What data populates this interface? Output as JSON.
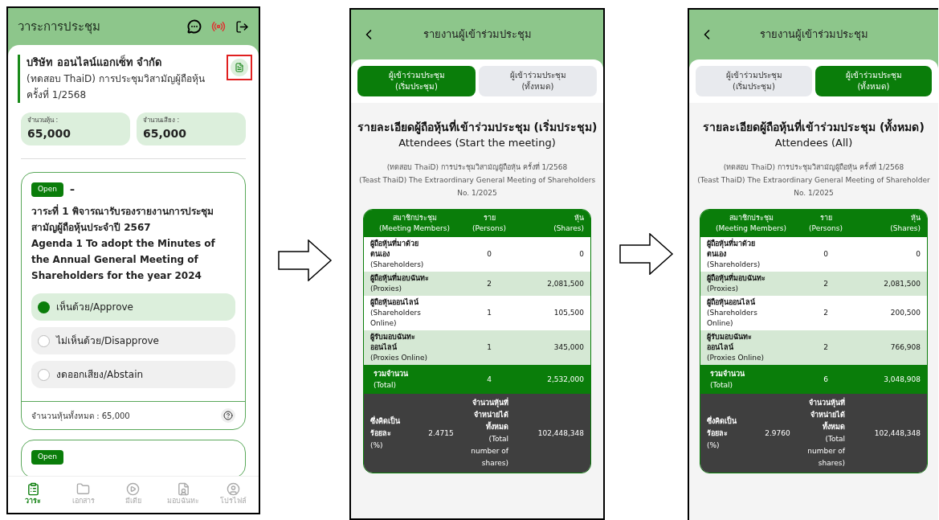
{
  "agenda_screen": {
    "title": "วาระการประชุม",
    "company": {
      "name": "บริษัท ออนไลน์แอกเซ็ท จำกัด",
      "meeting": "(ทดสอบ ThaiD) การประชุมวิสามัญผู้ถือหุ้น ครั้งที่ 1/2568",
      "document_marked": true
    },
    "stats": [
      {
        "label": "จำนวนหุ้น :",
        "value": "65,000"
      },
      {
        "label": "จำนวนเสียง :",
        "value": "65,000"
      }
    ],
    "agendas": [
      {
        "status": "Open",
        "suffix": "–",
        "title_th": "วาระที่ 1 พิจารณารับรองรายงานการประชุมสามัญผู้ถือหุ้นประจำปี 2567",
        "title_en": "Agenda 1 To adopt the Minutes of the Annual General Meeting of Shareholders for the year 2024",
        "options": [
          {
            "label": "เห็นด้วย/Approve",
            "selected": true
          },
          {
            "label": "ไม่เห็นด้วย/Disapprove",
            "selected": false
          },
          {
            "label": "งดออกเสียง/Abstain",
            "selected": false
          }
        ],
        "total": "จำนวนหุ้นทั้งหมด : 65,000"
      },
      {
        "status": "Open"
      }
    ],
    "nav": [
      {
        "label": "วาระ",
        "selected": true
      },
      {
        "label": "เอกสาร",
        "selected": false
      },
      {
        "label": "มีเดีย",
        "selected": false
      },
      {
        "label": "มอบฉันทะ",
        "selected": false
      },
      {
        "label": "โปรไฟล์",
        "selected": false
      }
    ]
  },
  "reports": [
    {
      "title": "รายงานผู้เข้าร่วมประชุม",
      "tabs": [
        {
          "line1": "ผู้เข้าร่วมประชุม",
          "line2": "(เริ่มประชุม)",
          "selected": true
        },
        {
          "line1": "ผู้เข้าร่วมประชุม",
          "line2": "(ทั้งหมด)",
          "selected": false
        }
      ],
      "heading_th": "รายละเอียดผู้ถือหุ้นที่เข้าร่วมประชุม (เริ่มประชุม)",
      "heading_en": "Attendees (Start the meeting)",
      "meeting_th": "(ทดสอบ ThaiD) การประชุมวิสามัญผู้ถือหุ้น ครั้งที่ 1/2568",
      "meeting_en": "(Teast ThaiD) The Extraordinary General Meeting of Shareholders",
      "meeting_no": "No. 1/2025",
      "columns": [
        {
          "th": "สมาชิกประชุม",
          "en": "(Meeting Members)"
        },
        {
          "th": "ราย",
          "en": "(Persons)"
        },
        {
          "th": "หุ้น",
          "en": "(Shares)"
        }
      ],
      "rows": [
        {
          "name_th": "ผู้ถือหุ้นที่มาด้วยตนเอง",
          "name_en": "(Shareholders)",
          "persons": "0",
          "shares": "0"
        },
        {
          "name_th": "ผู้ถือหุ้นที่มอบฉันทะ",
          "name_en": "(Proxies)",
          "persons": "2",
          "shares": "2,081,500"
        },
        {
          "name_th": "ผู้ถือหุ้นออนไลน์",
          "name_en": "(Shareholders Online)",
          "persons": "1",
          "shares": "105,500"
        },
        {
          "name_th": "ผู้รับมอบฉันทะออนไลน์",
          "name_en": "(Proxies Online)",
          "persons": "1",
          "shares": "345,000"
        }
      ],
      "total": {
        "th": "รวมจำนวน",
        "en": "(Total)",
        "persons": "4",
        "shares": "2,532,000"
      },
      "summary": {
        "label_th": "ซึ่งคิดเป็นร้อยละ",
        "label_en": "(%)",
        "percent": "2.4715",
        "shares_label_th": "จำนวนหุ้นที่จำหน่ายได้ทั้งหมด",
        "shares_label_en": "(Total number of shares)",
        "total_shares": "102,448,348"
      }
    },
    {
      "title": "รายงานผู้เข้าร่วมประชุม",
      "tabs": [
        {
          "line1": "ผู้เข้าร่วมประชุม",
          "line2": "(เริ่มประชุม)",
          "selected": false
        },
        {
          "line1": "ผู้เข้าร่วมประชุม",
          "line2": "(ทั้งหมด)",
          "selected": true
        }
      ],
      "heading_th": "รายละเอียดผู้ถือหุ้นที่เข้าร่วมประชุม (ทั้งหมด)",
      "heading_en": "Attendees (All)",
      "meeting_th": "(ทดสอบ ThaiD) การประชุมวิสามัญผู้ถือหุ้น ครั้งที่ 1/2568",
      "meeting_en": "(Teast ThaiD) The Extraordinary General Meeting of Shareholder",
      "meeting_no": "No. 1/2025",
      "columns": [
        {
          "th": "สมาชิกประชุม",
          "en": "(Meeting Members)"
        },
        {
          "th": "ราย",
          "en": "(Persons)"
        },
        {
          "th": "หุ้น",
          "en": "(Shares)"
        }
      ],
      "rows": [
        {
          "name_th": "ผู้ถือหุ้นที่มาด้วยตนเอง",
          "name_en": "(Shareholders)",
          "persons": "0",
          "shares": "0"
        },
        {
          "name_th": "ผู้ถือหุ้นที่มอบฉันทะ",
          "name_en": "(Proxies)",
          "persons": "2",
          "shares": "2,081,500"
        },
        {
          "name_th": "ผู้ถือหุ้นออนไลน์",
          "name_en": "(Shareholders Online)",
          "persons": "2",
          "shares": "200,500"
        },
        {
          "name_th": "ผู้รับมอบฉันทะออนไลน์",
          "name_en": "(Proxies Online)",
          "persons": "2",
          "shares": "766,908"
        }
      ],
      "total": {
        "th": "รวมจำนวน",
        "en": "(Total)",
        "persons": "6",
        "shares": "3,048,908"
      },
      "summary": {
        "label_th": "ซึ่งคิดเป็นร้อยละ",
        "label_en": "(%)",
        "percent": "2.9760",
        "shares_label_th": "จำนวนหุ้นที่จำหน่ายได้ทั้งหมด",
        "shares_label_en": "(Total number of shares)",
        "total_shares": "102,448,348"
      }
    }
  ]
}
